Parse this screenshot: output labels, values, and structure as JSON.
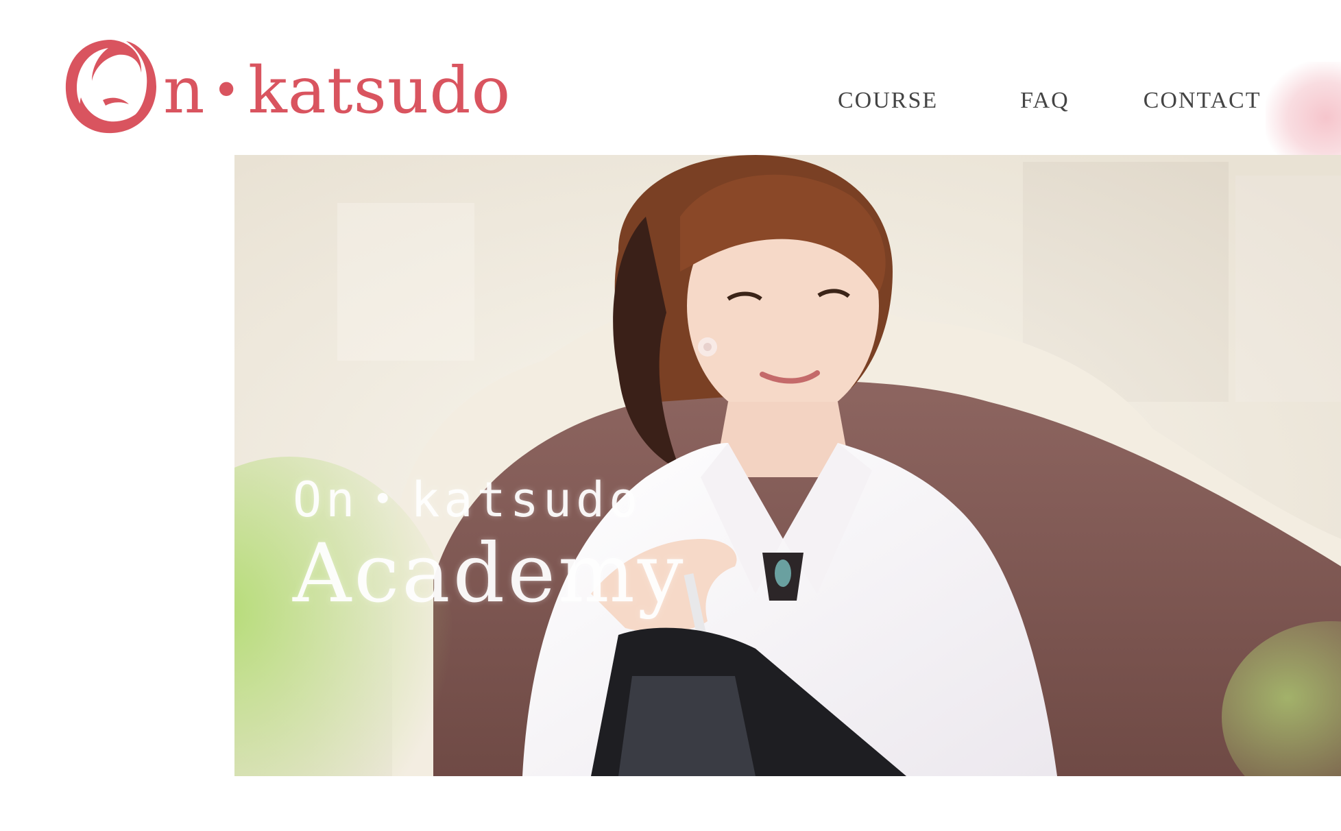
{
  "brand": {
    "logo_text_left": "n",
    "logo_dot": "•",
    "logo_text_right": "katsudo",
    "color": "#d9545f"
  },
  "nav": {
    "items": [
      {
        "label": "COURSE"
      },
      {
        "label": "FAQ"
      },
      {
        "label": "CONTACT"
      }
    ]
  },
  "hero": {
    "line1": "On・katsudo",
    "line2": "Academy",
    "photo_icon": "portrait-photo"
  }
}
